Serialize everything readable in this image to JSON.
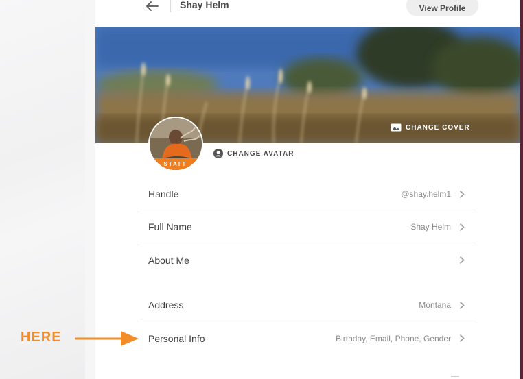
{
  "header": {
    "title": "Shay Helm",
    "view_profile_label": "View Profile"
  },
  "cover": {
    "change_cover_label": "CHANGE COVER"
  },
  "avatar": {
    "badge": "STAFF",
    "change_avatar_label": "CHANGE AVATAR"
  },
  "settings": {
    "rows": [
      {
        "label": "Handle",
        "value": "@shay.helm1"
      },
      {
        "label": "Full Name",
        "value": "Shay Helm"
      },
      {
        "label": "About Me",
        "value": ""
      },
      {
        "label": "Address",
        "value": "Montana"
      },
      {
        "label": "Personal Info",
        "value": "Birthday, Email, Phone, Gender"
      }
    ]
  },
  "annotation": {
    "label": "HERE",
    "color": "#f28c28"
  },
  "colors": {
    "accent": "#f27d1f",
    "frame_edge": "#5a2437"
  },
  "icons": [
    "back-arrow-icon",
    "image-icon",
    "account-circle-icon",
    "chevron-right-icon"
  ]
}
